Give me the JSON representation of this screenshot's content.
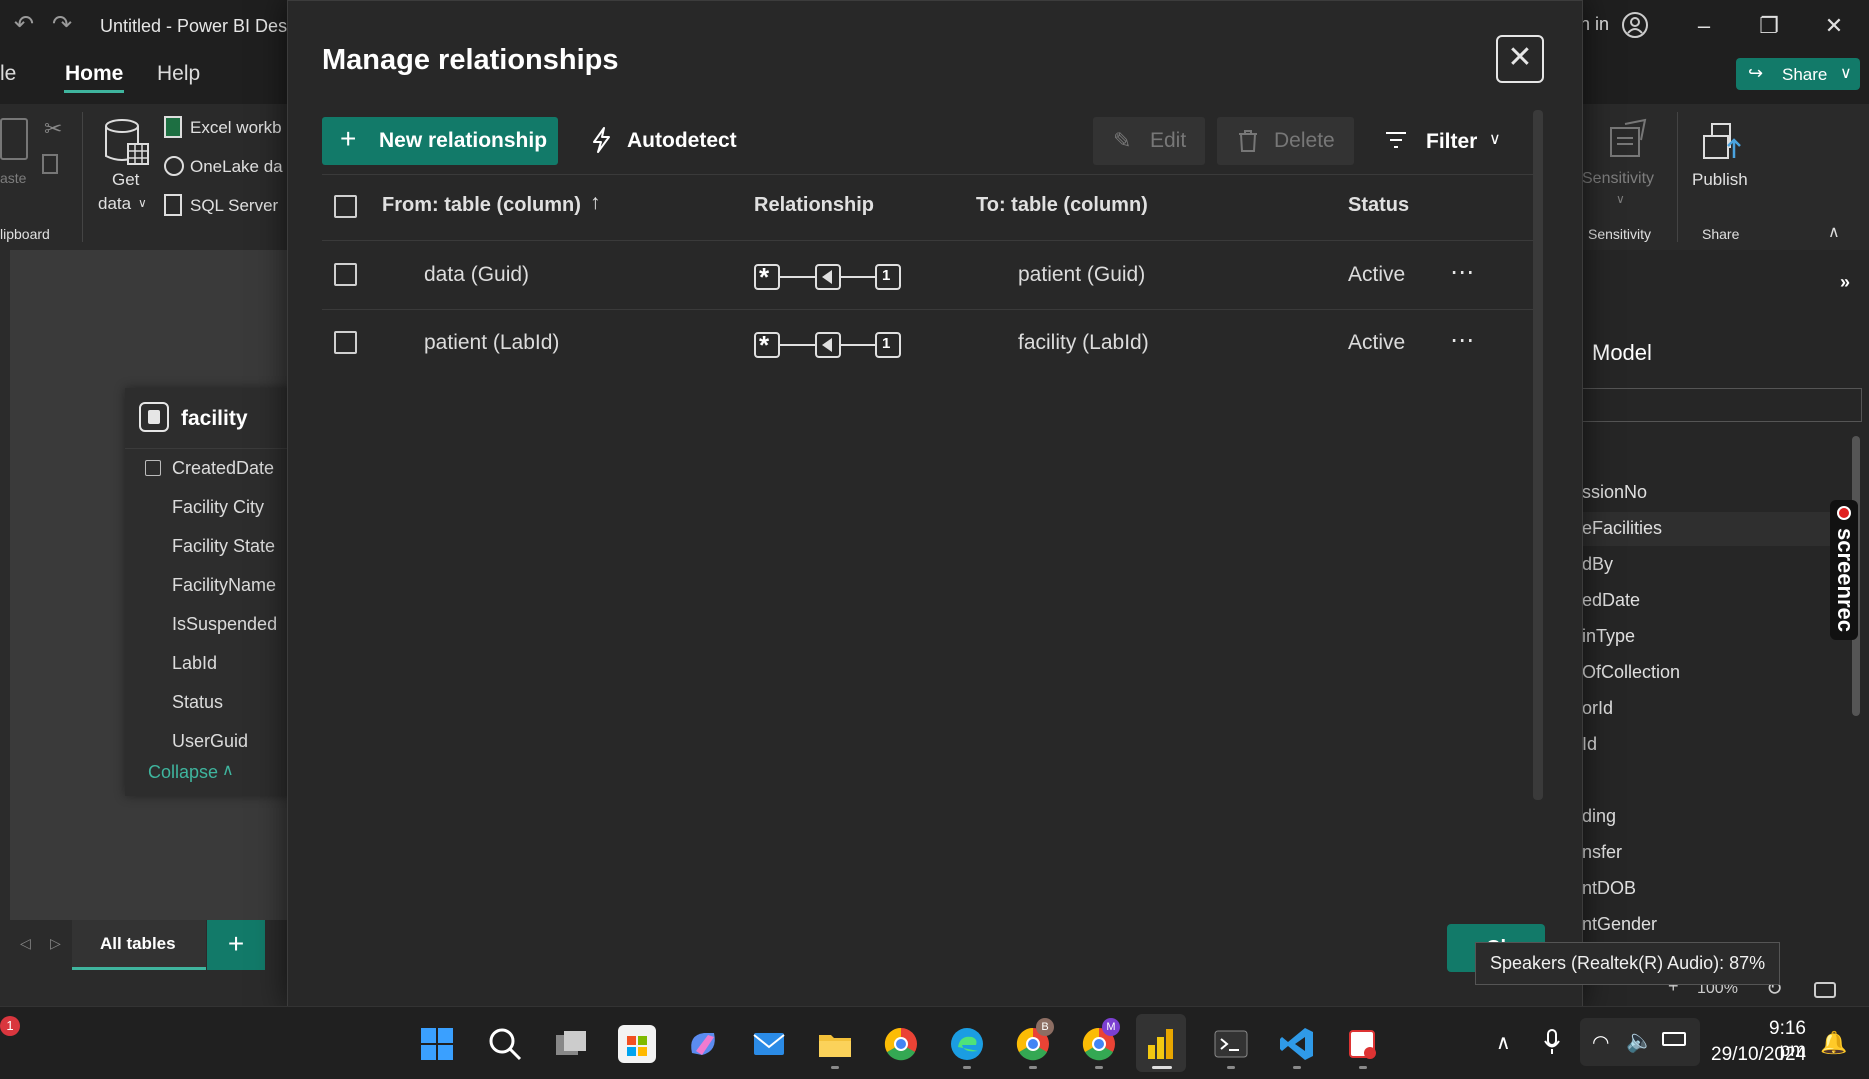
{
  "window": {
    "title": "Untitled - Power BI Desk",
    "sign_in_fragment": "n in",
    "share_label": "Share"
  },
  "ribbon": {
    "tabs": {
      "file": "le",
      "home": "Home",
      "help": "Help"
    },
    "paste_label": "aste",
    "clipboard_group": "lipboard",
    "get_data": {
      "line1": "Get",
      "line2": "data"
    },
    "sources": [
      "Excel workb",
      "OneLake da",
      "SQL Server"
    ],
    "sensitivity_button": "Sensitivity",
    "sensitivity_group": "Sensitivity",
    "publish_button": "Publish",
    "share_group": "Share"
  },
  "canvas": {
    "table": {
      "name": "facility",
      "fields": [
        "CreatedDate",
        "Facility City",
        "Facility State",
        "FacilityName",
        "IsSuspended",
        "LabId",
        "Status",
        "UserGuid"
      ],
      "collapse_label": "Collapse"
    },
    "bottom_tab": "All tables",
    "add_tab": "+"
  },
  "right_panel": {
    "title": "Model",
    "items": [
      "ssionNo",
      "eFacilities",
      "dBy",
      "edDate",
      "inType",
      "OfCollection",
      "orId",
      "Id",
      "ding",
      "nsfer",
      "ntDOB",
      "ntGender"
    ],
    "zoom_fragment": "100%"
  },
  "dialog": {
    "title": "Manage relationships",
    "buttons": {
      "new_relationship": "New relationship",
      "autodetect": "Autodetect",
      "edit": "Edit",
      "delete": "Delete",
      "filter": "Filter",
      "close": "Cl"
    },
    "columns": {
      "from": "From: table (column)",
      "relationship": "Relationship",
      "to": "To: table (column)",
      "status": "Status"
    },
    "rows": [
      {
        "from": "data (Guid)",
        "many": "*",
        "one": "1",
        "to": "patient (Guid)",
        "status": "Active"
      },
      {
        "from": "patient (LabId)",
        "many": "*",
        "one": "1",
        "to": "facility (LabId)",
        "status": "Active"
      }
    ]
  },
  "tooltip": "Speakers (Realtek(R) Audio): 87%",
  "side_badge": "screenrec",
  "taskbar": {
    "notification_count": "1",
    "badge_b": "B",
    "badge_m": "M",
    "time": "9:16 pm",
    "date": "29/10/2024"
  },
  "colors": {
    "accent": "#127a69",
    "accent_light": "#3fb59e",
    "dialog_bg": "#282828",
    "ribbon_bg": "#2a2a2a"
  }
}
